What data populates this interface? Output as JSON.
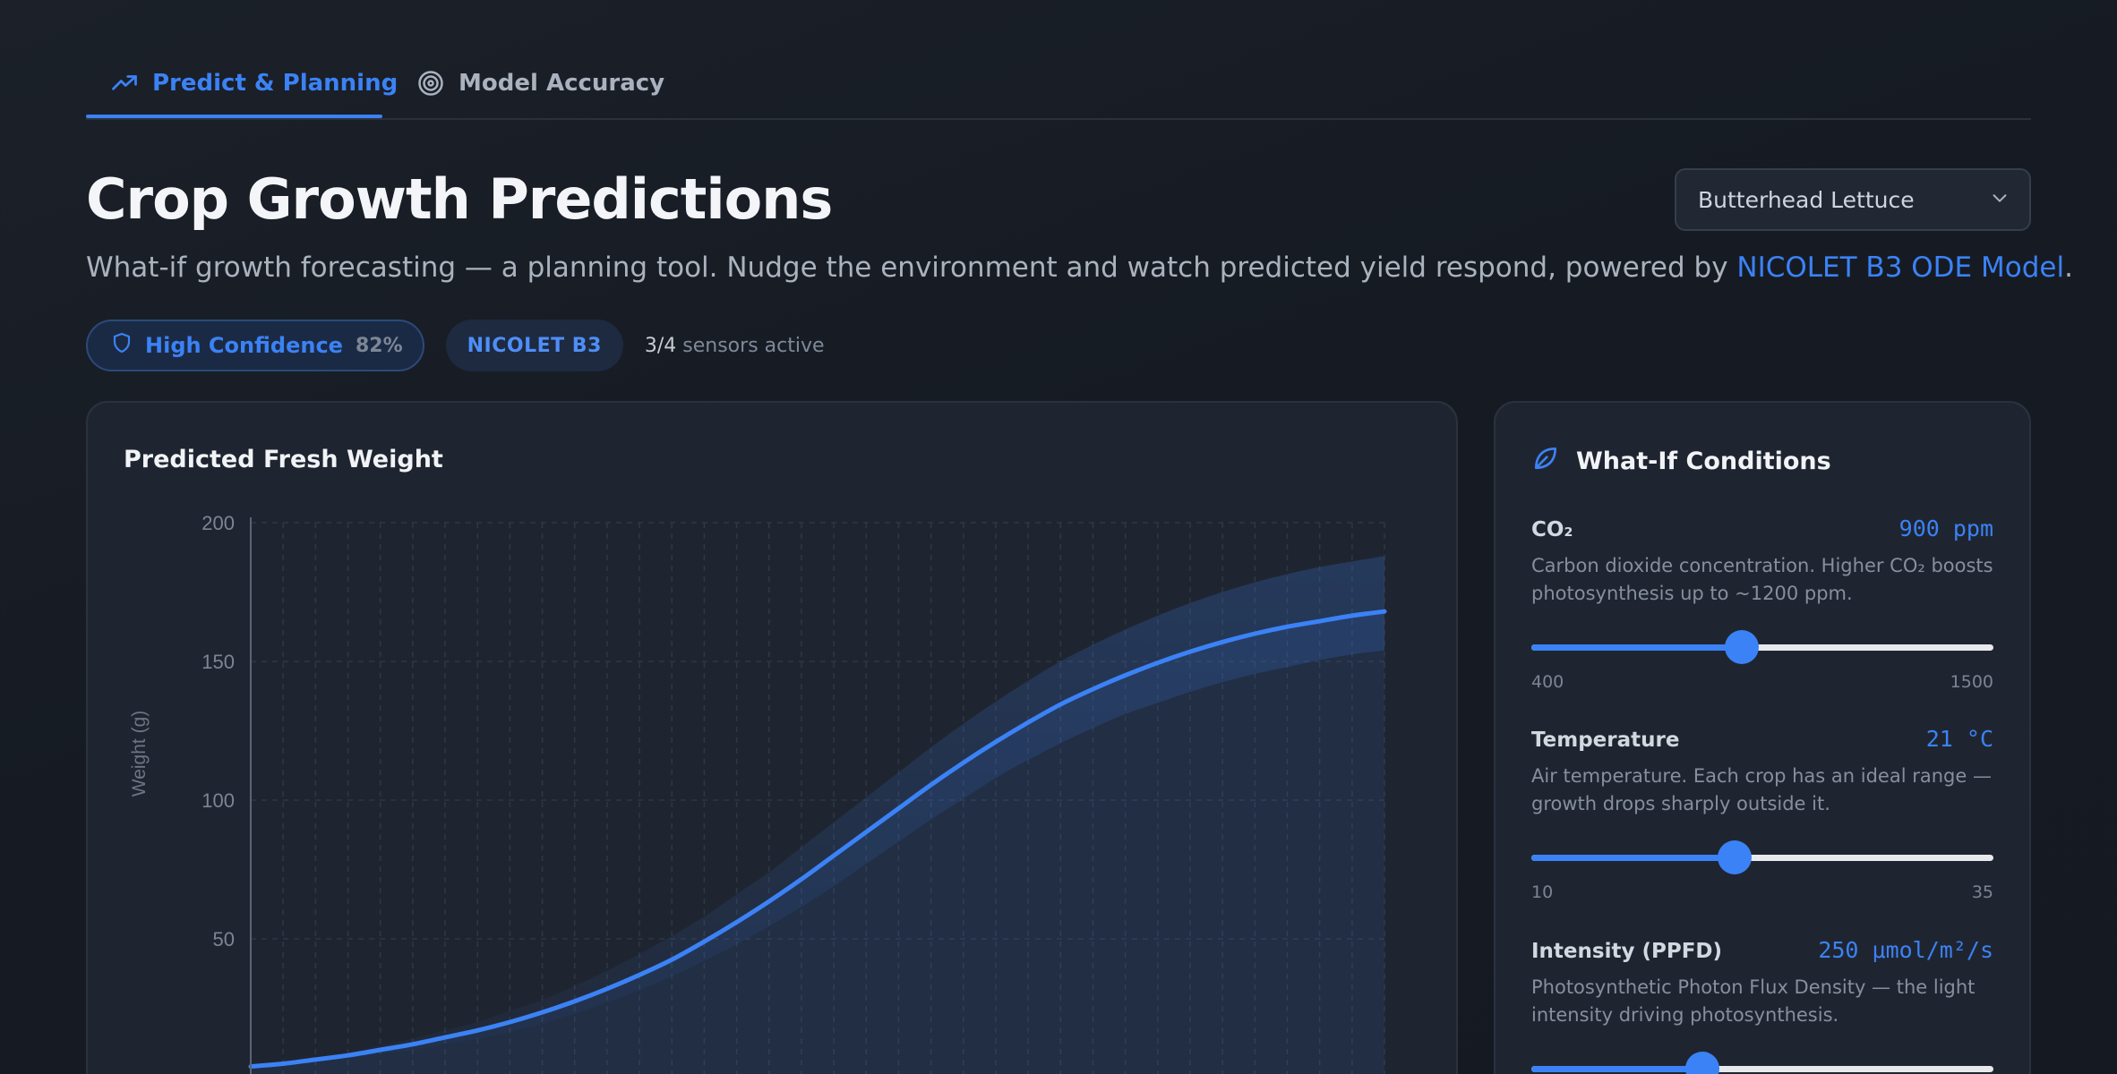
{
  "tabs": [
    {
      "label": "Predict & Planning",
      "icon": "trending-up-icon",
      "active": true
    },
    {
      "label": "Model Accuracy",
      "icon": "target-icon",
      "active": false
    }
  ],
  "header": {
    "title": "Crop Growth Predictions",
    "subtitle_text": "What-if growth forecasting — a planning tool. Nudge the environment and watch predicted yield respond, powered by ",
    "subtitle_link": "NICOLET B3 ODE Model",
    "subtitle_end": "."
  },
  "crop_select": {
    "value": "Butterhead Lettuce"
  },
  "badges": {
    "confidence_label": "High Confidence",
    "confidence_pct": "82%",
    "model": "NICOLET B3",
    "sensors_count": "3/4",
    "sensors_label": "sensors active"
  },
  "chart_data": {
    "type": "line",
    "title": "Predicted Fresh Weight",
    "ylabel": "Weight (g)",
    "xlabel": "",
    "ylim": [
      0,
      200
    ],
    "yticks": [
      200,
      150,
      100,
      50
    ],
    "grid": true,
    "x": [
      0,
      1,
      2,
      3,
      4,
      5,
      6,
      7,
      8,
      9,
      10,
      11,
      12,
      13,
      14,
      15,
      16,
      17,
      18,
      19,
      20,
      21,
      22,
      23,
      24,
      25,
      26,
      27,
      28,
      29,
      30,
      31,
      32,
      33,
      34,
      35
    ],
    "series": [
      {
        "values": [
          4,
          5,
          6.5,
          8,
          10,
          12,
          14.5,
          17,
          20,
          23.5,
          27.5,
          32,
          37,
          42.5,
          49,
          56,
          63.5,
          71.5,
          80,
          88.5,
          97,
          105.5,
          113.5,
          121,
          128,
          134.5,
          140,
          145,
          149.5,
          153.5,
          157,
          160,
          162.5,
          164.5,
          166.5,
          168
        ]
      }
    ],
    "band_upper": [
      4,
      5.5,
      7,
      9,
      11.5,
      14,
      17,
      20,
      24,
      28,
      33,
      38.5,
      44.5,
      51,
      58,
      66,
      74,
      83,
      92,
      101,
      110,
      119,
      127.5,
      135.5,
      143,
      150,
      156,
      161.5,
      166.5,
      171,
      175,
      178.5,
      181.5,
      184,
      186,
      188
    ],
    "band_lower": [
      4,
      4.8,
      6,
      7,
      8.5,
      10,
      12,
      14,
      16.5,
      19.5,
      23,
      27,
      31.5,
      36.5,
      42,
      48,
      54.5,
      61.5,
      69,
      77,
      85,
      93,
      100.5,
      108,
      114.5,
      120.5,
      126,
      131,
      135,
      139,
      142.5,
      145.5,
      148,
      150.5,
      152.5,
      154
    ],
    "colors": {
      "line": "#3b82f6",
      "band": "#3b82f6",
      "grid": "#2f3744",
      "axis": "#5b6473"
    }
  },
  "whatif": {
    "title": "What-If Conditions",
    "icon": "leaf-icon",
    "params": [
      {
        "name": "CO₂",
        "value": "900 ppm",
        "desc": "Carbon dioxide concentration. Higher CO₂ boosts photosynthesis up to ~1200 ppm.",
        "min": "400",
        "max": "1500",
        "fraction": 0.455
      },
      {
        "name": "Temperature",
        "value": "21 °C",
        "desc": "Air temperature. Each crop has an ideal range — growth drops sharply outside it.",
        "min": "10",
        "max": "35",
        "fraction": 0.44
      },
      {
        "name": "Intensity (PPFD)",
        "value": "250 μmol/m²/s",
        "desc": "Photosynthetic Photon Flux Density — the light intensity driving photosynthesis.",
        "min": "",
        "max": "",
        "fraction": 0.37
      }
    ]
  },
  "colors": {
    "accent": "#3b82f6",
    "background": "#171c24",
    "card": "#1f2530"
  }
}
